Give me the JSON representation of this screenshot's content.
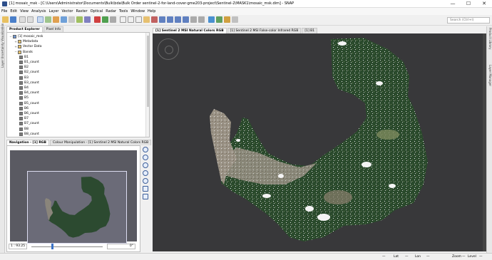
{
  "window": {
    "title": "[1] mosaic_msk - [C:\\Users\\Administrator\\Documents\\Bulk\\bda\\Bulk Order sentinel-2-for-land-cover-gme203-project\\Sentinel-2\\MASK1\\mosaic_msk.dim] - SNAP",
    "min": "—",
    "max": "☐",
    "close": "✕"
  },
  "menu": [
    "File",
    "Edit",
    "View",
    "Analysis",
    "Layer",
    "Vector",
    "Raster",
    "Optical",
    "Radar",
    "Tools",
    "Window",
    "Help"
  ],
  "search": {
    "placeholder": "Search (Ctrl+I)"
  },
  "left_strip": {
    "label": "Layer Uncertainty Visualization"
  },
  "right_strip": {
    "label1": "Product Library",
    "label2": "Layer Manager"
  },
  "explorer": {
    "tabs": [
      "Product Explorer",
      "Pixel Info"
    ],
    "tree": [
      {
        "text": "[1] mosaic_msk",
        "indent": 0,
        "exp": "−",
        "icon": "product"
      },
      {
        "text": "Metadata",
        "indent": 1,
        "exp": "+",
        "icon": "folder"
      },
      {
        "text": "Vector Data",
        "indent": 1,
        "exp": "+",
        "icon": "folder"
      },
      {
        "text": "Bands",
        "indent": 1,
        "exp": "−",
        "icon": "folder"
      },
      {
        "text": "B1",
        "indent": 2,
        "icon": "band"
      },
      {
        "text": "B1_count",
        "indent": 2,
        "icon": "band"
      },
      {
        "text": "B2",
        "indent": 2,
        "icon": "band"
      },
      {
        "text": "B2_count",
        "indent": 2,
        "icon": "band"
      },
      {
        "text": "B3",
        "indent": 2,
        "icon": "band"
      },
      {
        "text": "B3_count",
        "indent": 2,
        "icon": "band"
      },
      {
        "text": "B4",
        "indent": 2,
        "icon": "band"
      },
      {
        "text": "B4_count",
        "indent": 2,
        "icon": "band"
      },
      {
        "text": "B5",
        "indent": 2,
        "icon": "band"
      },
      {
        "text": "B5_count",
        "indent": 2,
        "icon": "band"
      },
      {
        "text": "B6",
        "indent": 2,
        "icon": "band"
      },
      {
        "text": "B6_count",
        "indent": 2,
        "icon": "band"
      },
      {
        "text": "B7",
        "indent": 2,
        "icon": "band"
      },
      {
        "text": "B7_count",
        "indent": 2,
        "icon": "band"
      },
      {
        "text": "B8",
        "indent": 2,
        "icon": "band"
      },
      {
        "text": "B8_count",
        "indent": 2,
        "icon": "band"
      }
    ]
  },
  "navigation": {
    "tabs": [
      "Navigation - [1] RGB",
      "Colour Manipulation - [1] Sentinel 2 MSI Natural Colors RGB"
    ],
    "zoom": "1 : 93.25",
    "rotation": "0°"
  },
  "view_tabs": [
    "[1] Sentinel 2 MSI Natural Colors RGB",
    "[1] Sentinel 2 MSI False-color Infrared RGB",
    "[1] B1"
  ],
  "status": {
    "lat": "Lat",
    "lon": "Lon",
    "zoom": "Zoom",
    "level": "Level",
    "dash": "—"
  },
  "colors": {
    "accent": "#3a72c7",
    "view_bg": "#38383a",
    "veg_dark": "#1f3a22",
    "veg_mid": "#3f5a38",
    "urban": "#9a9285",
    "cloud": "#f4f4f4"
  }
}
